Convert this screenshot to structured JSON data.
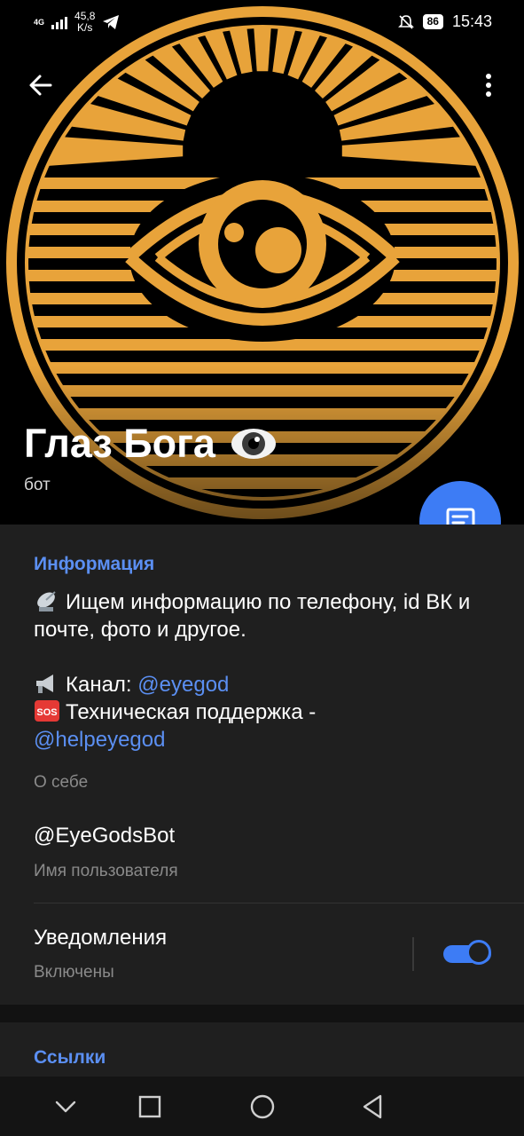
{
  "status_bar": {
    "network": "4G",
    "speed_value": "45,8",
    "speed_unit": "K/s",
    "battery": "86",
    "time": "15:43"
  },
  "profile": {
    "name": "Глаз Бога",
    "subtitle": "бот"
  },
  "info": {
    "section_title": "Информация",
    "about_line1": "Ищем информацию по телефону, id ВК и почте, фото и другое.",
    "channel_label": "Канал: ",
    "channel_link": "@eyegod",
    "support_label": "Техническая поддержка -",
    "support_link": "@helpeyegod",
    "about_caption": "О себе",
    "username": "@EyeGodsBot",
    "username_caption": "Имя пользователя",
    "notifications_title": "Уведомления",
    "notifications_state": "Включены",
    "notifications_on": true
  },
  "links": {
    "section_title": "Ссылки"
  },
  "colors": {
    "accent": "#3d7cf5",
    "link": "#5b8ff2",
    "gold": "#e8a33a",
    "background": "#1f1f1f"
  }
}
